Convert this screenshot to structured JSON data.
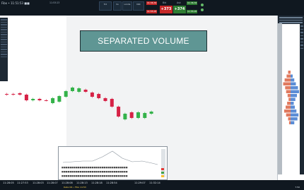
{
  "window": {
    "title": "Fibo • 11:51:53 ■■",
    "clock": "11:53:23"
  },
  "toolbar": {
    "buttons": [
      "Trd",
      "Vo",
      "Limits",
      "Mkt"
    ],
    "bid": {
      "label": "Bid",
      "value": "+373",
      "size": "11:36.34"
    },
    "ask": {
      "label": "Ask",
      "value": "+374",
      "size": "11:36.34"
    },
    "tags": [
      "11:55.05",
      "11:55.05"
    ],
    "colors": {
      "bid": "#c62828",
      "ask": "#2e7d32",
      "bar": "#101820"
    }
  },
  "banner": {
    "text": "SEPARATED VOLUME",
    "color": "#5f9694"
  },
  "time_axis": {
    "labels": [
      "11:28:05",
      "11:27:53",
      "11:28:03",
      "11:28:07",
      "11:28:08",
      "11:28:13",
      "11:28:18",
      "11:28:54",
      "11:29:07",
      "11:32:14"
    ]
  },
  "status_bar": {
    "left": "Data OK  •  Fibo 11:53",
    "right": "7.50"
  },
  "candles": [
    {
      "o": 121,
      "c": 122,
      "up": false
    },
    {
      "o": 121,
      "c": 122,
      "up": false
    },
    {
      "o": 120,
      "c": 122,
      "up": false
    },
    {
      "o": 122,
      "c": 130,
      "up": false
    },
    {
      "o": 128,
      "c": 130,
      "up": true
    },
    {
      "o": 130,
      "c": 128,
      "up": false
    },
    {
      "o": 130,
      "c": 130,
      "up": false
    },
    {
      "o": 127,
      "c": 134,
      "up": true
    },
    {
      "o": 124,
      "c": 132,
      "up": true
    },
    {
      "o": 117,
      "c": 125,
      "up": true
    },
    {
      "o": 112,
      "c": 117,
      "up": true
    },
    {
      "o": 113,
      "c": 118,
      "up": true
    },
    {
      "o": 115,
      "c": 118,
      "up": false
    },
    {
      "o": 119,
      "c": 125,
      "up": false
    },
    {
      "o": 121,
      "c": 127,
      "up": false
    },
    {
      "o": 127,
      "c": 131,
      "up": false
    },
    {
      "o": 128,
      "c": 139,
      "up": false
    },
    {
      "o": 139,
      "c": 153,
      "up": false
    },
    {
      "o": 149,
      "c": 157,
      "up": true
    },
    {
      "o": 147,
      "c": 155,
      "up": false
    },
    {
      "o": 147,
      "c": 155,
      "up": true
    },
    {
      "o": 148,
      "c": 155,
      "up": true
    },
    {
      "o": 146,
      "c": 149,
      "up": true
    }
  ],
  "volume_profile": [
    {
      "a": 5,
      "b": 0
    },
    {
      "a": 8,
      "b": 4
    },
    {
      "a": 12,
      "b": 7
    },
    {
      "a": 15,
      "b": 10
    },
    {
      "a": 11,
      "b": 14
    },
    {
      "a": 9,
      "b": 16
    },
    {
      "a": 6,
      "b": 12
    },
    {
      "a": 4,
      "b": 9
    },
    {
      "a": 7,
      "b": 6
    },
    {
      "a": 10,
      "b": 8
    },
    {
      "a": 13,
      "b": 11
    },
    {
      "a": 9,
      "b": 15
    },
    {
      "a": 5,
      "b": 13
    },
    {
      "a": 3,
      "b": 7
    }
  ]
}
